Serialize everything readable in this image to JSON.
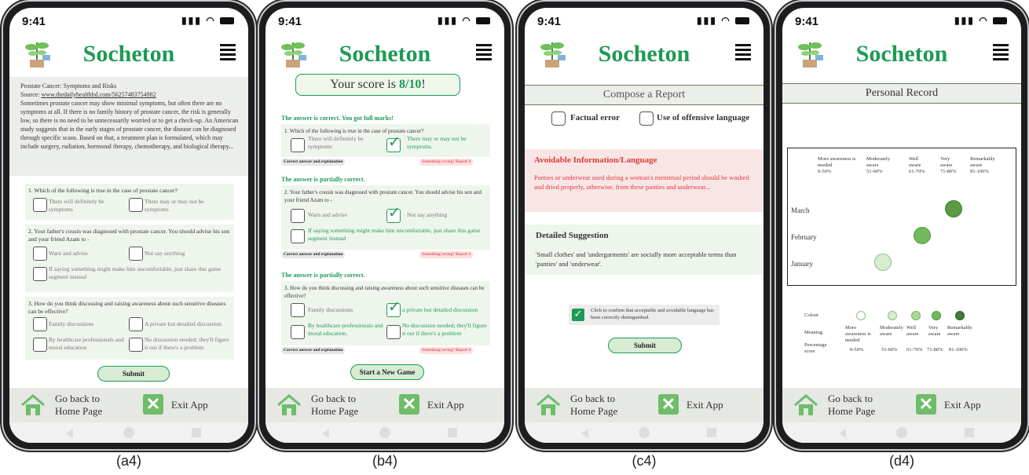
{
  "app": {
    "name": "Socheton",
    "time": "9:41",
    "footer": {
      "home_label_line1": "Go back to",
      "home_label_line2": "Home Page",
      "exit_label": "Exit App"
    }
  },
  "colors": {
    "brand_green": "#1d9a55",
    "light_green": "#d7ecd2",
    "panel_bg": "#eef5ec",
    "error_red": "#e03a3a"
  },
  "captions": [
    "(a4)",
    "(b4)",
    "(c4)",
    "(d4)"
  ],
  "screen_a": {
    "article": {
      "title": "Prostate Cancer: Symptoms and Risks",
      "source_prefix": "Source: ",
      "source_url": "www.thedailyhealthbd.com/56257483754982",
      "body": "Sometimes prostate cancer may show minimal symptoms, but often there are no symptoms at all. If there is no family history of prostate cancer, the risk is generally low, so there is no need to be unnecessarily worried or to get a check-up. An American study suggests that in the early stages of prostate cancer, the disease can be diagnosed through specific scans. Based on that, a treatment plan is formulated, which may include surgery, radiation, hormonal therapy, chemotherapy, and biological therapy..."
    },
    "q1": {
      "text": "1. Which of the following is true in the case of prostate cancer?",
      "opt1": "There will definitely be symptoms",
      "opt2": "There may or may not be symptoms"
    },
    "q2": {
      "text": "2. Your father's cousin was diagnosed with prostate cancer. You should advise his son and your friend Azam to -",
      "opt1": "Warn and advise",
      "opt2": "Not say anything",
      "opt3": "If saying something might make him uncomfortable, just share this game segment instead"
    },
    "q3": {
      "text": "3. How do you think discussing and raising awareness about such sensitive diseases can be effective?",
      "opt1": "Family discussions",
      "opt2": "A private but detailed discussion",
      "opt3": "By healthcare professionals and moral education",
      "opt4": "No discussion needed; they'll figure it out if there's a problem"
    },
    "submit_label": "Submit"
  },
  "screen_b": {
    "score_prefix": "Your score is ",
    "score_value": "8/10",
    "score_suffix": "!",
    "r1": {
      "result": "The answer is correct. You got full marks!",
      "text": "1. Which of the following is true in the case of prostate cancer?",
      "opt1": "There will definitely be symptoms",
      "opt2": "There may or may not be symptoms."
    },
    "r2": {
      "result": "The answer is partially correct.",
      "text": "2. Your father's cousin was diagnosed with prostate cancer. You should advise his son and your friend Azam to -",
      "opt1": "Warn and advise",
      "opt2": "Not say anything",
      "opt3": "If saying something might make him uncomfortable, just share this game segment instead"
    },
    "r3": {
      "result": "The answer is partially correct.",
      "text": "3. How do you think discussing and raising awareness about such sensitive diseases can be effective?",
      "opt1": "Family discussions",
      "opt2": "a private but detailed discussion",
      "opt3": "By healthcare professionals and moral education.",
      "opt4": "No discussion needed; they'll figure it out if there's a problem"
    },
    "explain_label": "Correct answer and explanation",
    "report_label": "Something wrong? Report it",
    "new_game_label": "Start a New Game"
  },
  "screen_c": {
    "title": "Compose a Report",
    "opt_factual": "Factual error",
    "opt_offensive": "Use of offensive language",
    "avoidable_heading": "Avoidable Information/Language",
    "avoidable_text": "Panties or underwear used during a woman's menstrual period should be washed and dried properly, otherwise, from these panties and underwear...",
    "suggestion_heading": "Detailed Suggestion",
    "suggestion_text": "'Small clothes' and 'undergarments' are socially more acceptable terms than 'panties' and 'underwear'.",
    "confirm_text": "Click to confirm that acceptable and avoidable language has been correctly distinguished.",
    "submit_label": "Submit"
  },
  "screen_d": {
    "title": "Personal Record",
    "columns": [
      {
        "name": "More awareness is needed",
        "range": "0-50%"
      },
      {
        "name": "Moderately aware",
        "range": "51-60%"
      },
      {
        "name": "Well aware",
        "range": "61-70%"
      },
      {
        "name": "Very aware",
        "range": "71-80%"
      },
      {
        "name": "Remarkably aware",
        "range": "81-100%"
      }
    ],
    "months": [
      {
        "label": "March",
        "level": 4
      },
      {
        "label": "February",
        "level": 3
      },
      {
        "label": "January",
        "level": 2
      }
    ],
    "legend": {
      "colour_label": "Colour",
      "meaning_label": "Meaning",
      "percentage_label": "Percentage score",
      "meanings": [
        "More awareness is needed",
        "Moderately aware",
        "Well aware",
        "Very aware",
        "Remarkably aware"
      ],
      "ranges": [
        "0-50%",
        "51-60%",
        "61-70%",
        "71-80%",
        "81-100%"
      ],
      "colours": [
        "#ffffff",
        "#d8ecd0",
        "#a9d89e",
        "#72b85c",
        "#3f7d34"
      ]
    }
  }
}
